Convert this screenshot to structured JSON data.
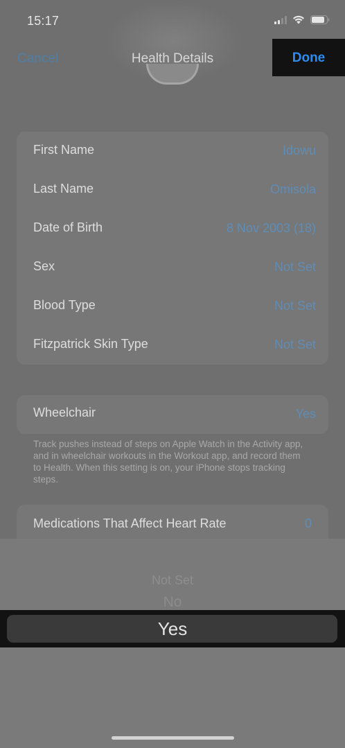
{
  "status_bar": {
    "time": "15:17"
  },
  "nav": {
    "cancel_label": "Cancel",
    "title": "Health Details",
    "done_label": "Done"
  },
  "details": {
    "rows": [
      {
        "label": "First Name",
        "value": "Idowu"
      },
      {
        "label": "Last Name",
        "value": "Omisola"
      },
      {
        "label": "Date of Birth",
        "value": "8 Nov 2003 (18)"
      },
      {
        "label": "Sex",
        "value": "Not Set"
      },
      {
        "label": "Blood Type",
        "value": "Not Set"
      },
      {
        "label": "Fitzpatrick Skin Type",
        "value": "Not Set"
      }
    ]
  },
  "wheelchair": {
    "label": "Wheelchair",
    "value": "Yes",
    "footer": "Track pushes instead of steps on Apple Watch in the Activity app, and in wheelchair workouts in the Workout app, and record them to Health. When this setting is on, your iPhone stops tracking steps."
  },
  "medications": {
    "label": "Medications That Affect Heart Rate",
    "value": "0"
  },
  "picker": {
    "options": [
      "Not Set",
      "No",
      "Yes"
    ],
    "selected": "Yes"
  },
  "colors": {
    "done": "#2c8cf0",
    "value_text": "#5f8db5",
    "dim_overlay": "#6f6f6f"
  },
  "icons": [
    "signal-icon",
    "wifi-icon",
    "battery-icon"
  ]
}
